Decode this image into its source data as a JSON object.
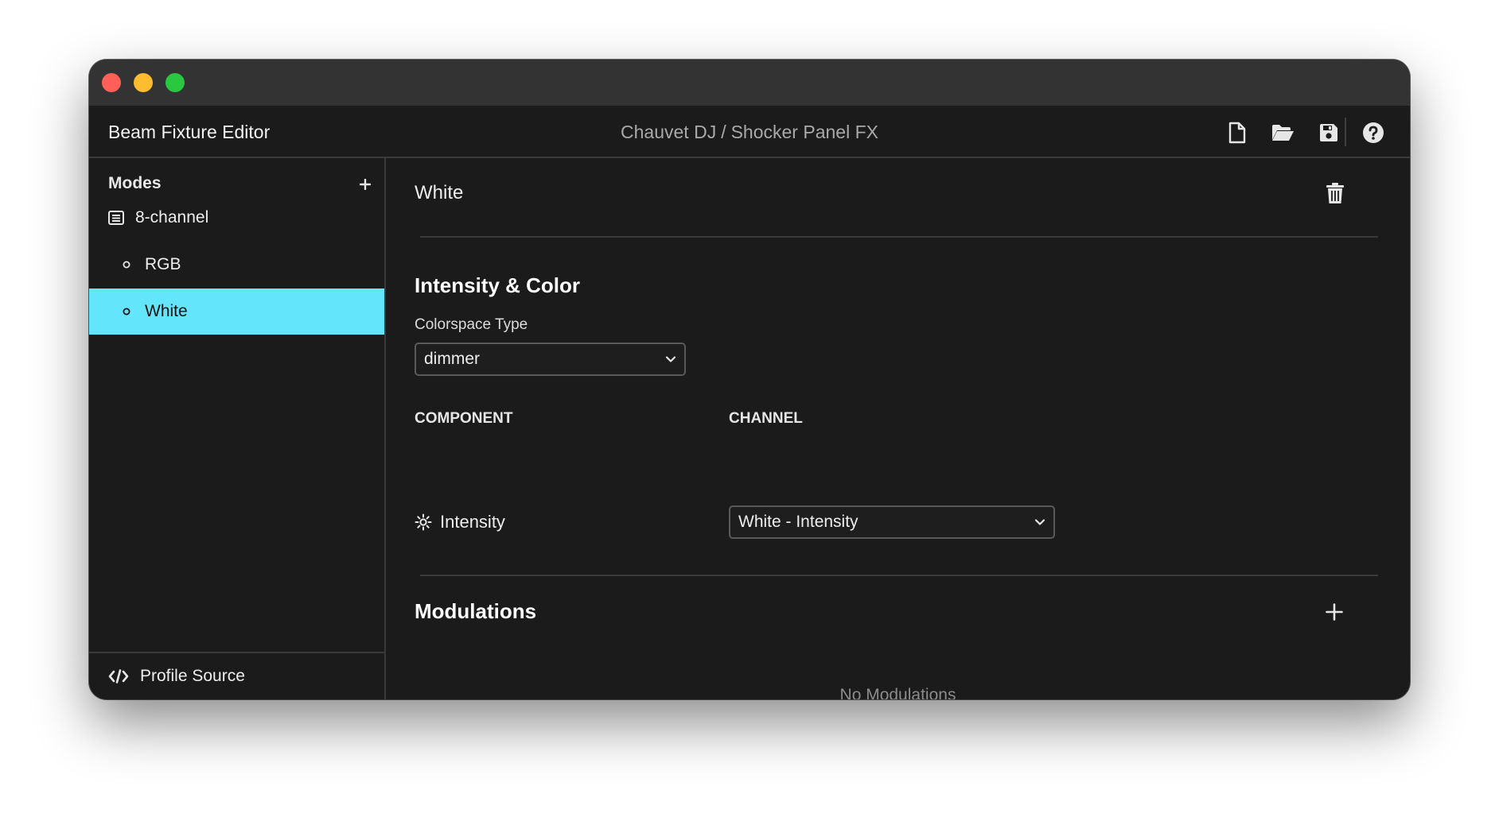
{
  "app": {
    "title": "Beam Fixture Editor",
    "manufacturer": "Chauvet DJ",
    "separator": "/",
    "fixture": "Shocker Panel FX"
  },
  "toolbar": {
    "icons": [
      "new-file-icon",
      "open-folder-icon",
      "save-icon",
      "help-icon"
    ]
  },
  "sidebar": {
    "modes_label": "Modes",
    "mode": {
      "label": "8-channel",
      "icon": "list-icon"
    },
    "items": [
      {
        "label": "RGB",
        "active": false
      },
      {
        "label": "White",
        "active": true
      }
    ],
    "footer_label": "Profile Source"
  },
  "main": {
    "mode_name": "White",
    "intensity_section": {
      "title": "Intensity & Color",
      "colorspace_label": "Colorspace Type",
      "colorspace_value": "dimmer",
      "component_header": "COMPONENT",
      "channel_header": "CHANNEL",
      "component_label": "Intensity",
      "channel_value": "White - Intensity"
    },
    "modulations": {
      "title": "Modulations",
      "empty_message": "No Modulations"
    }
  },
  "colors": {
    "accent": "#63e6fb",
    "background": "#1b1b1b",
    "titlebar": "#333333",
    "close": "#fe5f57",
    "minimize": "#febc2e",
    "maximize": "#29c840"
  }
}
